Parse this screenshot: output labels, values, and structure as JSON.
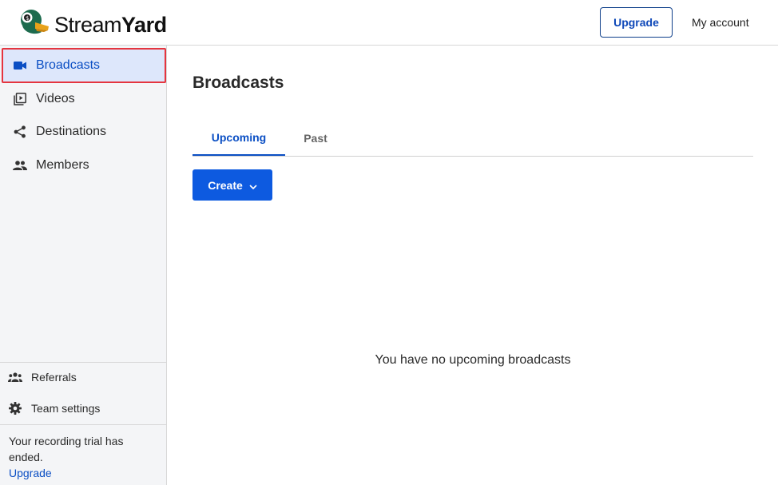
{
  "header": {
    "logo_regular": "Stream",
    "logo_bold": "Yard",
    "upgrade_label": "Upgrade",
    "account_label": "My account"
  },
  "sidebar": {
    "items": [
      {
        "label": "Broadcasts",
        "icon": "video-camera-icon",
        "active": true
      },
      {
        "label": "Videos",
        "icon": "video-library-icon",
        "active": false
      },
      {
        "label": "Destinations",
        "icon": "share-icon",
        "active": false
      },
      {
        "label": "Members",
        "icon": "people-icon",
        "active": false
      }
    ],
    "bottom_items": [
      {
        "label": "Referrals",
        "icon": "referrals-icon"
      },
      {
        "label": "Team settings",
        "icon": "gear-icon"
      }
    ],
    "trial_text": "Your recording trial has ended.",
    "trial_link": "Upgrade"
  },
  "main": {
    "title": "Broadcasts",
    "tabs": [
      {
        "label": "Upcoming",
        "active": true
      },
      {
        "label": "Past",
        "active": false
      }
    ],
    "create_label": "Create",
    "empty_message": "You have no upcoming broadcasts"
  },
  "colors": {
    "accent": "#0d5ae0",
    "active_nav_bg": "#dde7fb",
    "highlight_border": "#e5353f"
  }
}
